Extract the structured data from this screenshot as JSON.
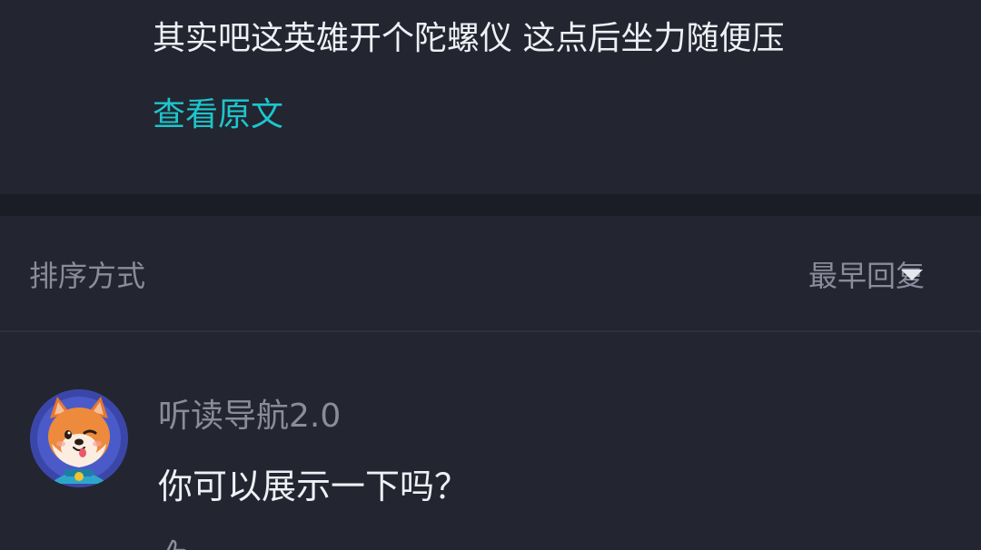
{
  "post": {
    "text": "其实吧这英雄开个陀螺仪 这点后坐力随便压",
    "view_original": "查看原文"
  },
  "sort": {
    "label": "排序方式",
    "selected": "最早回复",
    "caret_icon": "caret-down-icon"
  },
  "comment": {
    "username": "听读导航2.0",
    "text": "你可以展示一下吗？",
    "avatar_icon": "shiba-dog-avatar"
  },
  "colors": {
    "background": "#232531",
    "divider": "#1b1d26",
    "primary_text": "#eef0f5",
    "secondary_text": "#8a8d99",
    "accent": "#1cc6cc"
  }
}
